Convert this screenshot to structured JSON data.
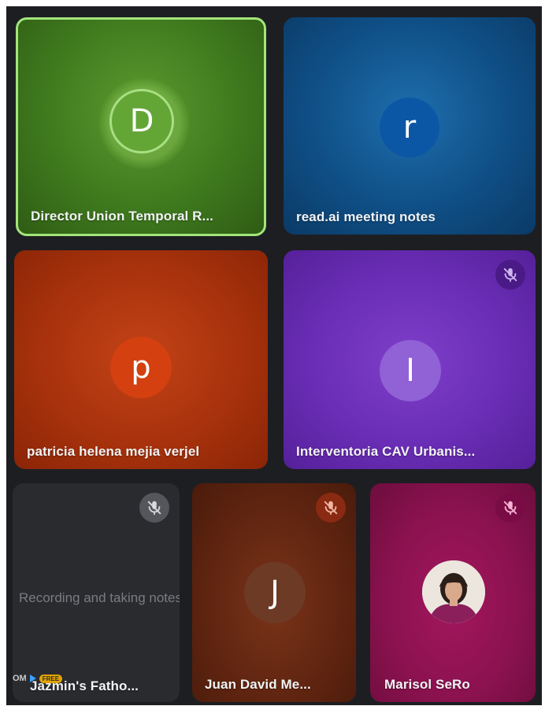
{
  "participants": [
    {
      "id": "t1",
      "name": "Director Union Temporal R...",
      "initial": "D",
      "color": "#63a636",
      "speaking": true,
      "muted": false
    },
    {
      "id": "t2",
      "name": "read.ai meeting notes",
      "initial": "r",
      "color": "#0c57a5",
      "speaking": false,
      "muted": false
    },
    {
      "id": "t3",
      "name": "patricia helena mejia verjel",
      "initial": "p",
      "color": "#d4400f",
      "speaking": false,
      "muted": false
    },
    {
      "id": "t4",
      "name": "Interventoria CAV Urbanis...",
      "initial": "I",
      "color": "#9161d6",
      "speaking": false,
      "muted": true
    },
    {
      "id": "t5",
      "name": "Jazmin's Fatho...",
      "screen_text": "Recording and taking notes",
      "strip_text": "OM",
      "badge": "FREE",
      "muted": true
    },
    {
      "id": "t6",
      "name": "Juan David Me...",
      "initial": "J",
      "color": "#6d3a26",
      "speaking": false,
      "muted": true
    },
    {
      "id": "t7",
      "name": "Marisol SeRo",
      "avatar": "photo",
      "muted": true
    }
  ],
  "colors": {
    "speaking_border": "#a3e57a",
    "background": "#1d1e22"
  },
  "icons": {
    "muted": "mic-off-icon"
  }
}
